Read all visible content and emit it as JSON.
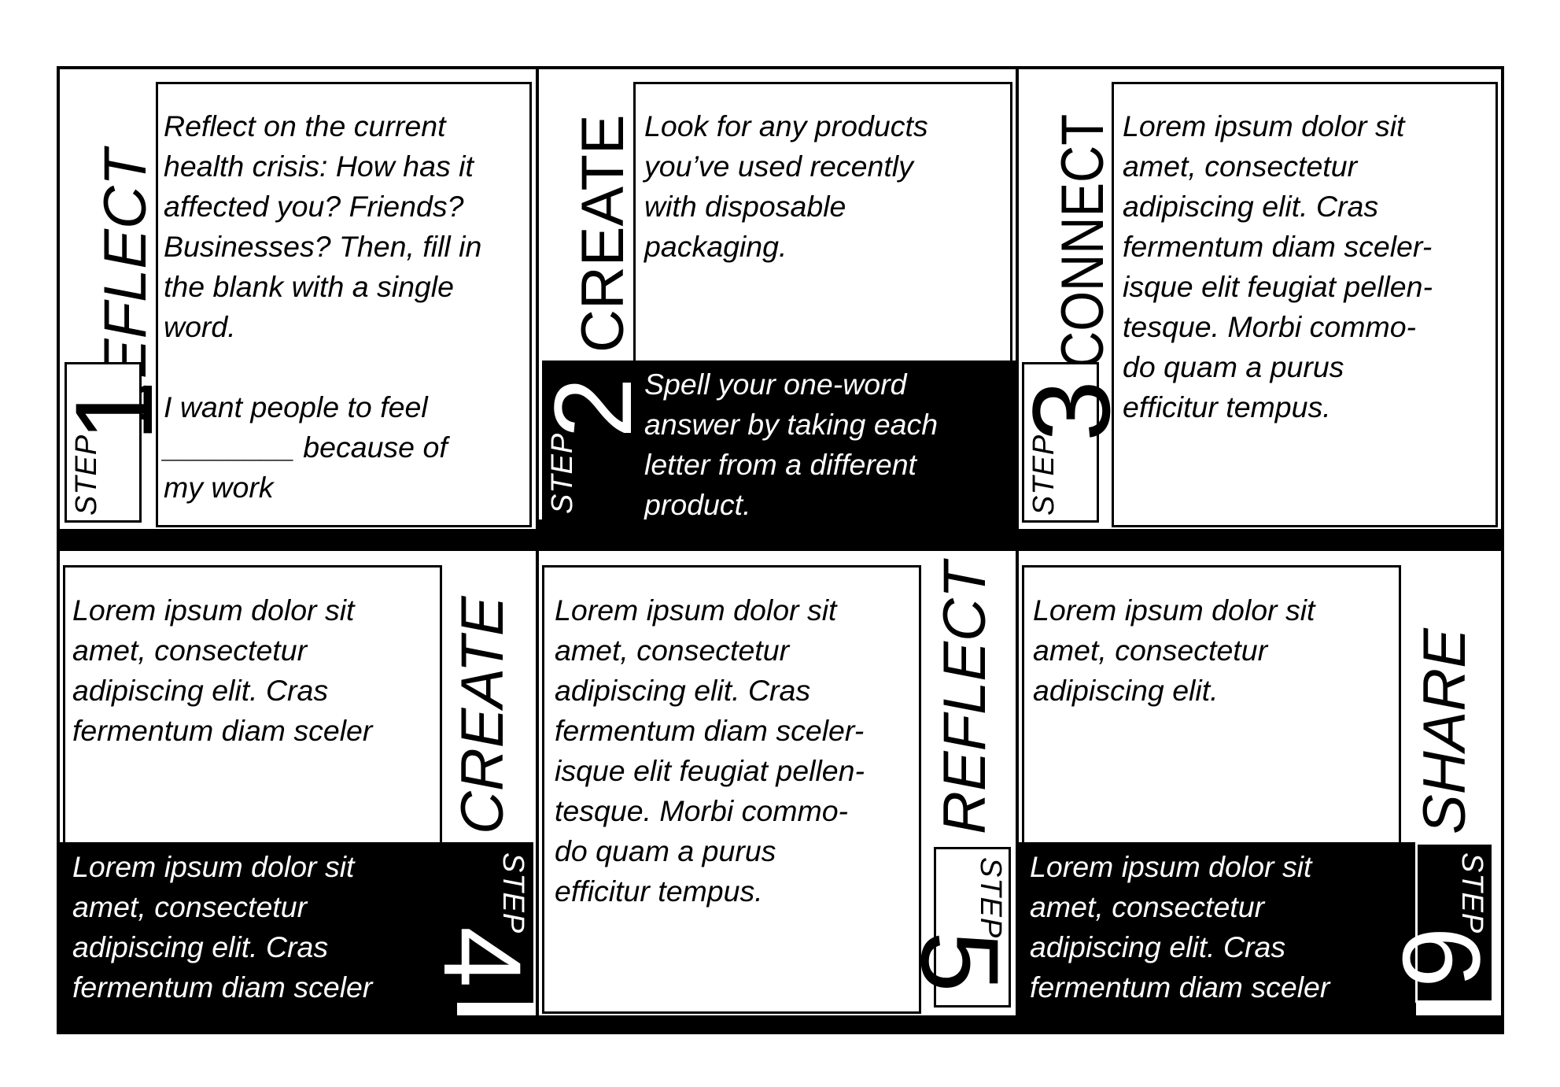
{
  "cards": [
    {
      "step_label": "STEP",
      "number": "1",
      "title": "REFLECT",
      "text": "Reflect on the current\nhealth crisis: How has it\naffected you? Friends?\nBusinesses? Then, fill in\nthe blank with a single\nword.\n\nI want people to feel\n________ because of\nmy work"
    },
    {
      "step_label": "STEP",
      "number": "2",
      "title": "CREATE",
      "text": "Look for any products\nyou’ve used recently\nwith disposable\npackaging.",
      "bottom_text": "Spell your one-word\nanswer by taking each\nletter from a different\nproduct."
    },
    {
      "step_label": "STEP",
      "number": "3",
      "title": "CONNECT",
      "text": "Lorem ipsum dolor sit\namet, consectetur\nadipiscing elit. Cras\nfermentum diam sceler-\nisque elit feugiat pellen-\ntesque. Morbi commo-\ndo quam a purus\nefficitur tempus."
    },
    {
      "step_label": "STEP",
      "number": "4",
      "title": "CREATE",
      "text": "Lorem ipsum dolor sit\namet, consectetur\nadipiscing elit. Cras\nfermentum diam sceler",
      "bottom_text": "Lorem ipsum dolor sit\namet, consectetur\nadipiscing elit. Cras\nfermentum diam sceler"
    },
    {
      "step_label": "STEP",
      "number": "5",
      "title": "REFLECT",
      "text": "Lorem ipsum dolor sit\namet, consectetur\nadipiscing elit. Cras\nfermentum diam sceler-\nisque elit feugiat pellen-\ntesque. Morbi commo-\ndo quam a purus\nefficitur tempus."
    },
    {
      "step_label": "STEP",
      "number": "6",
      "title": "SHARE",
      "text": "Lorem ipsum dolor sit\namet, consectetur\nadipiscing elit.",
      "bottom_text": "Lorem ipsum dolor sit\namet, consectetur\nadipiscing elit. Cras\nfermentum diam sceler"
    }
  ]
}
